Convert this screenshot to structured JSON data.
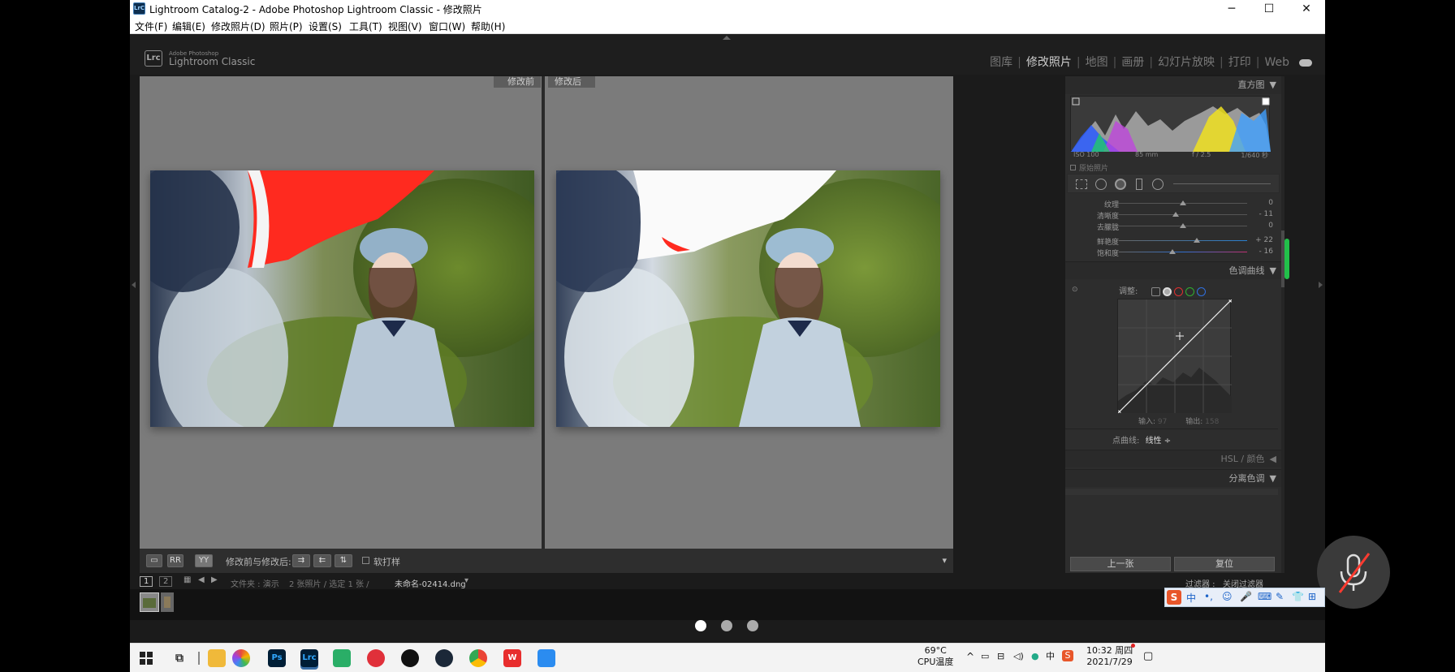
{
  "window": {
    "title": "Lightroom Catalog-2 - Adobe Photoshop Lightroom Classic - 修改照片",
    "app_icon": "LrC",
    "controls": [
      "─",
      "☐",
      "✕"
    ]
  },
  "menu": [
    "文件(F)",
    "编辑(E)",
    "修改照片(D)",
    "照片(P)",
    "设置(S)",
    "工具(T)",
    "视图(V)",
    "窗口(W)",
    "帮助(H)"
  ],
  "logo": {
    "mark": "Lrc",
    "small": "Adobe Photoshop",
    "big": "Lightroom Classic"
  },
  "modules": {
    "items": [
      "图库",
      "修改照片",
      "地图",
      "画册",
      "幻灯片放映",
      "打印",
      "Web"
    ],
    "active": "修改照片",
    "separator": "|"
  },
  "center": {
    "before_label": "修改前",
    "after_label": "修改后"
  },
  "toolbar": {
    "view_buttons": [
      "▭",
      "RR",
      "YY"
    ],
    "label": "修改前与修改后:",
    "soft_proof": "软打样",
    "chevron": "▾"
  },
  "right_panel": {
    "histogram": {
      "title": "直方图",
      "meta": [
        "ISO 100",
        "85 mm",
        "f / 2.5",
        "1/640 秒"
      ],
      "original_photo": "原始照片"
    },
    "sliders": [
      {
        "label": "纹理",
        "value": "0",
        "pos": 0.5
      },
      {
        "label": "清晰度",
        "value": "- 11",
        "pos": 0.44
      },
      {
        "label": "去朦胧",
        "value": "0",
        "pos": 0.5
      },
      {
        "label": "鲜艳度",
        "value": "+ 22",
        "pos": 0.61
      },
      {
        "label": "饱和度",
        "value": "- 16",
        "pos": 0.42
      }
    ],
    "tone_curve": {
      "title": "色调曲线",
      "adjust": "调整:",
      "input_label": "输入:",
      "input_value": "97",
      "output_label": "输出:",
      "output_value": "158",
      "point_curve_label": "点曲线:",
      "point_curve_value": "线性 ÷"
    },
    "hsl": "HSL / 颜色",
    "split": "分离色调",
    "prev_button": "上一张",
    "reset_button": "复位"
  },
  "filmstrip": {
    "pages": [
      "1",
      "2"
    ],
    "path": "文件夹 : 演示",
    "count": "2 张照片 / 选定 1 张 /",
    "file": "未命名-02414.dng",
    "filter": "过滤器 :",
    "filter_value": "关闭过滤器"
  },
  "taskbar": {
    "temp": "69°C",
    "temp_label": "CPU温度",
    "time": "10:32 周四",
    "date": "2021/7/29",
    "ime_lang": "中"
  },
  "ime_bar": [
    "S",
    "中",
    "•,",
    "☺",
    "🎤",
    "⌨",
    "✎",
    "👕",
    "⊞"
  ],
  "colors": {
    "lr_bg": "#1b1b1b",
    "panel": "#2d2d2d",
    "clip_red": "#ff2a1f",
    "taskbar": "#f3f3f3"
  }
}
